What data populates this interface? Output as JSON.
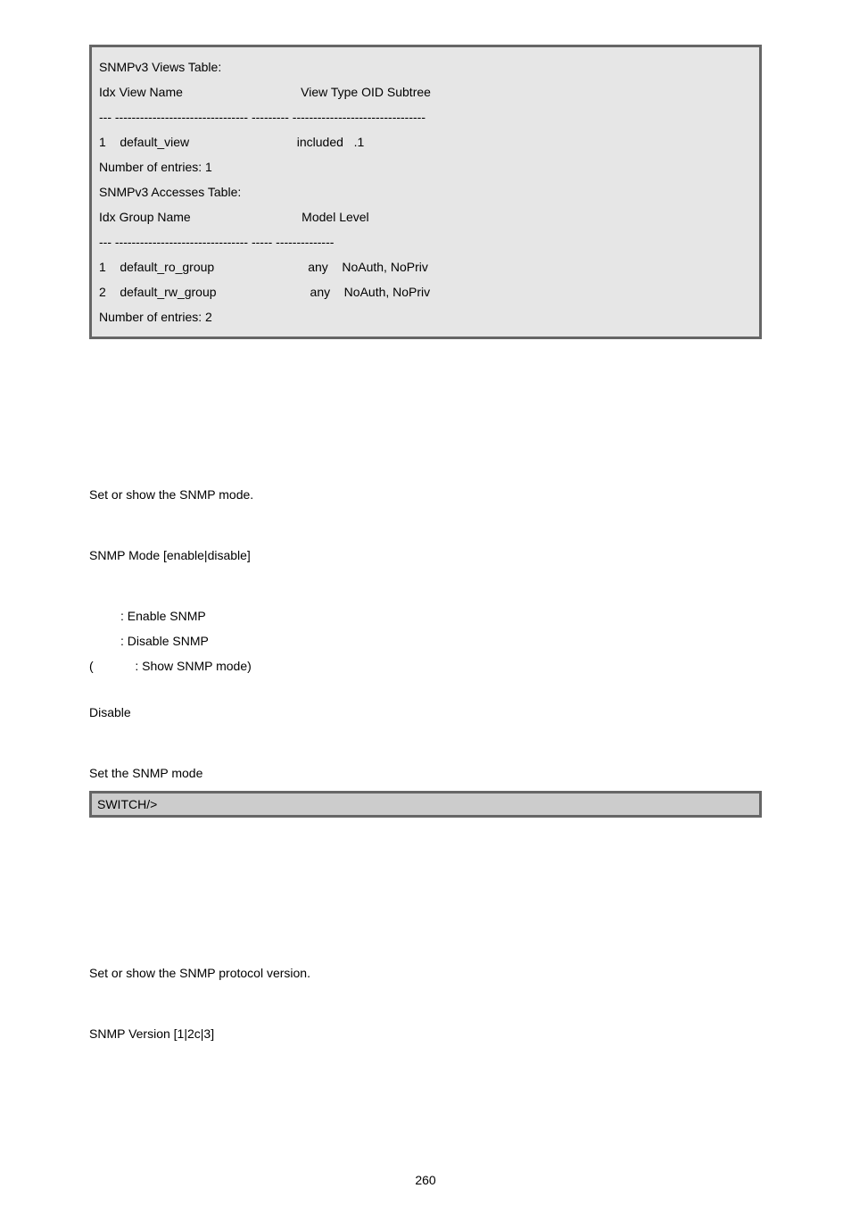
{
  "views_box": {
    "l1": "SNMPv3 Views Table:",
    "l2": "Idx View Name                                  View Type OID Subtree",
    "l3": "--- -------------------------------- --------- --------------------------------",
    "l4": "1    default_view                               included   .1",
    "l5": "Number of entries: 1",
    "l6": "",
    "l7": "SNMPv3 Accesses Table:",
    "l8": "Idx Group Name                                Model Level",
    "l9": "--- -------------------------------- ----- --------------",
    "l10": "1    default_ro_group                           any    NoAuth, NoPriv",
    "l11": "2    default_rw_group                           any    NoAuth, NoPriv",
    "l12": "",
    "l13": "Number of entries: 2"
  },
  "mode": {
    "desc": "Set or show the SNMP mode.",
    "syntax": "SNMP Mode [enable|disable]",
    "param1": "         : Enable SNMP",
    "param2": "         : Disable SNMP",
    "param3": "(            : Show SNMP mode)",
    "default": "Disable",
    "example_label": "Set the SNMP mode",
    "cmd": "SWITCH/>"
  },
  "version": {
    "desc": "Set or show the SNMP protocol version.",
    "syntax": "SNMP Version [1|2c|3]"
  },
  "page_number": "260"
}
